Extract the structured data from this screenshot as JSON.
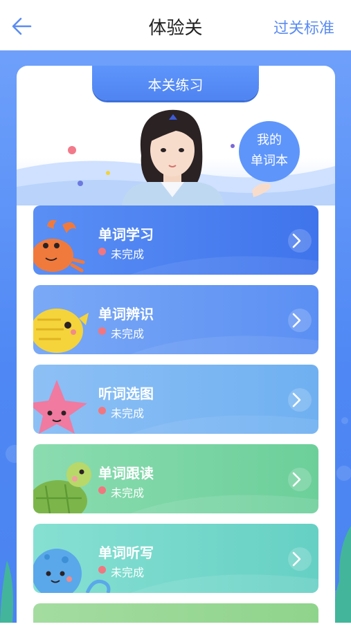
{
  "header": {
    "title": "体验关",
    "right_link": "过关标准"
  },
  "practice": {
    "tab_label": "本关练习",
    "wordbook": {
      "line1": "我的",
      "line2": "单词本"
    },
    "items": [
      {
        "label": "单词学习",
        "status": "未完成",
        "animal": "crab-icon"
      },
      {
        "label": "单词辨识",
        "status": "未完成",
        "animal": "fish-icon"
      },
      {
        "label": "听词选图",
        "status": "未完成",
        "animal": "starfish-icon"
      },
      {
        "label": "单词跟读",
        "status": "未完成",
        "animal": "turtle-icon"
      },
      {
        "label": "单词听写",
        "status": "未完成",
        "animal": "octopus-icon"
      }
    ]
  },
  "colors": {
    "accent": "#5b8cf2",
    "status_dot": "#f2767f",
    "card_gradients": [
      "#4f86f3",
      "#6a9ff7",
      "#7fb8f3",
      "#7fd2a6",
      "#7fd6c9"
    ]
  }
}
